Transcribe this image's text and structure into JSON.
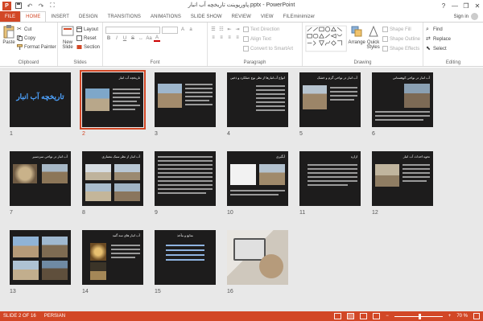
{
  "window": {
    "title": "پاورپوینت تاریخچه آب انبار.pptx - PowerPoint",
    "logo_letter": "P",
    "undo_glyph": "↶",
    "redo_glyph": "↷",
    "start_glyph": "⛶",
    "minimize": "—",
    "restore": "❐",
    "close": "✕",
    "help": "?"
  },
  "tabs": [
    "FILE",
    "HOME",
    "INSERT",
    "DESIGN",
    "TRANSITIONS",
    "ANIMATIONS",
    "SLIDE SHOW",
    "REVIEW",
    "VIEW",
    "FILEminimizer"
  ],
  "active_tab": "HOME",
  "signin": "Sign in",
  "ribbon": {
    "clipboard": {
      "label": "Clipboard",
      "paste": "Paste",
      "cut": "Cut",
      "copy": "Copy",
      "format_painter": "Format Painter"
    },
    "slides": {
      "label": "Slides",
      "new_slide_1": "New",
      "new_slide_2": "Slide",
      "layout": "Layout",
      "reset": "Reset",
      "section": "Section"
    },
    "font": {
      "label": "Font"
    },
    "paragraph": {
      "label": "Paragraph",
      "text_direction": "Text Direction",
      "align_text": "Align Text",
      "convert_smartart": "Convert to SmartArt"
    },
    "drawing": {
      "label": "Drawing",
      "arrange": "Arrange",
      "quick_styles_1": "Quick",
      "quick_styles_2": "Styles",
      "shape_fill": "Shape Fill",
      "shape_outline": "Shape Outline",
      "shape_effects": "Shape Effects"
    },
    "editing": {
      "label": "Editing",
      "find": "Find",
      "replace": "Replace",
      "select": "Select"
    }
  },
  "slides": [
    {
      "num": "1",
      "title": "تاریخچه آب انبار"
    },
    {
      "num": "2",
      "title": "تاریخچه آب انبار"
    },
    {
      "num": "3",
      "title": ""
    },
    {
      "num": "4",
      "title": "انواع آب‌انبارها از نظر نوع عملکرد و ذخیره"
    },
    {
      "num": "5",
      "title": "آب انبار در نواحی گرم و خشک"
    },
    {
      "num": "6",
      "title": "آب انبار در نواحی کوهستانی"
    },
    {
      "num": "7",
      "title": "آب انبار در نواحی سردسیر"
    },
    {
      "num": "8",
      "title": "آب انبار از نظر سبک معماری"
    },
    {
      "num": "9",
      "title": ""
    },
    {
      "num": "10",
      "title": "آبگیری"
    },
    {
      "num": "11",
      "title": "ازاره"
    },
    {
      "num": "12",
      "title": "نحوه احداث آب انبار"
    },
    {
      "num": "13",
      "title": ""
    },
    {
      "num": "14",
      "title": "آب انبار های سه گنبد"
    },
    {
      "num": "15",
      "title": "منابع و مآخذ"
    },
    {
      "num": "16",
      "title": ""
    }
  ],
  "status": {
    "slide_info": "SLIDE 2 OF 16",
    "language": "PERSIAN",
    "zoom": "70 %",
    "zoom_level": 0.5
  },
  "colors": {
    "accent": "#d24726",
    "slide_bg": "#1d1c1c"
  }
}
